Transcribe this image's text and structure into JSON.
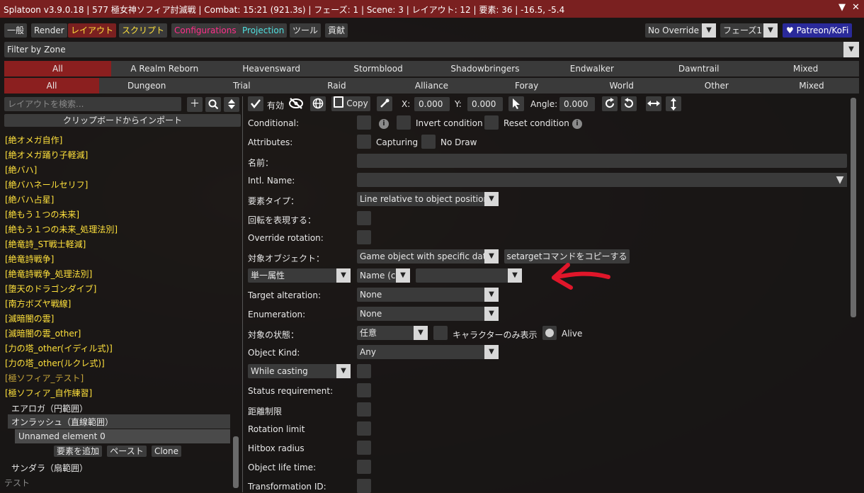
{
  "window": {
    "title": "Splatoon v3.9.0.18 | 577 極女神ソフィア討滅戦 | Combat: 15:21 (921.3s) | フェーズ: 1 | Scene: 3 | レイアウト: 12 | 要素: 36 | -16.5, -5.4",
    "collapse_glyph": "▼",
    "close_glyph": "✕"
  },
  "tabs": [
    {
      "label": "一般",
      "color": "#e8e8e8"
    },
    {
      "label": "Render",
      "color": "#e8e8e8"
    },
    {
      "label": "レイアウト",
      "color": "#ffe13c"
    },
    {
      "label": "スクリプト",
      "color": "#ffe13c"
    },
    {
      "label": "Configurations",
      "color": "#ff2e8a"
    },
    {
      "label": "Projection",
      "color": "#4fe0e0"
    },
    {
      "label": "ツール",
      "color": "#e8e8e8"
    },
    {
      "label": "貢献",
      "color": "#e8e8e8"
    }
  ],
  "top_right": {
    "no_override": "No Override",
    "phase": "フェーズ1",
    "patreon": "♥ Patreon/KoFi"
  },
  "filter": {
    "label": "Filter by Zone"
  },
  "expansions": [
    "All",
    "A Realm Reborn",
    "Heavensward",
    "Stormblood",
    "Shadowbringers",
    "Endwalker",
    "Dawntrail",
    "Mixed"
  ],
  "content_types": [
    "All",
    "Dungeon",
    "Trial",
    "Raid",
    "Alliance",
    "Foray",
    "World",
    "Other",
    "Mixed"
  ],
  "left": {
    "search_placeholder": "レイアウトを検索...",
    "import_button": "クリップボードからインポート",
    "zones": [
      "[絶オメガ自作]",
      "[絶オメガ踊り子軽減]",
      "[絶バハ]",
      "[絶バハネールセリフ]",
      "[絶バハ占星]",
      "[絶もう１つの未来]",
      "[絶もう１つの未来_処理法別]",
      "[絶竜詩_ST戦士軽減]",
      "[絶竜詩戦争]",
      "[絶竜詩戦争_処理法別]",
      "[堕天のドラゴンダイブ]",
      "[南方ボズヤ戦線]",
      "[滅暗闇の雲]",
      "[滅暗闇の雲_other]",
      "[力の塔_other(イディル式)]",
      "[力の塔_other(ルクレ式)]",
      "[極ソフィア_テスト]",
      "[極ソフィア_自作練習]"
    ],
    "layouts": {
      "aeroga": "エアロガ（円範囲）",
      "onrush": "オンラッシュ（直線範囲）",
      "unnamed": "Unnamed element 0",
      "sandaga": "サンダラ（扇範囲）",
      "test": "テスト"
    },
    "add_element": "要素を追加",
    "paste": "ペースト",
    "clone": "Clone"
  },
  "toolbar": {
    "enabled": "有効",
    "copy": "Copy",
    "x_label": "X:",
    "x_value": "0.000",
    "y_label": "Y:",
    "y_value": "0.000",
    "angle_label": "Angle:",
    "angle_value": "0.000"
  },
  "form": {
    "conditional": "Conditional:",
    "invert_condition": "Invert condition",
    "reset_condition": "Reset condition",
    "info_glyph": "i",
    "attributes": "Attributes:",
    "capturing": "Capturing",
    "no_draw": "No Draw",
    "name": "名前：",
    "intl_name": "Intl. Name:",
    "element_type": "要素タイプ：",
    "element_type_value": "Line relative to object position",
    "express_rotation": "回転を表現する：",
    "override_rotation": "Override rotation:",
    "target_object": "対象オブジェクト：",
    "target_object_value": "Game object with specific data",
    "copy_settarget": "setargetコマンドをコピーする",
    "single_attr": "単一属性",
    "name_combo": "Name (c",
    "name_combo_value": "",
    "target_alteration": "Target alteration:",
    "target_alteration_value": "None",
    "enumeration": "Enumeration:",
    "enumeration_value": "None",
    "target_state": "対象の状態：",
    "target_state_value": "任意",
    "character_only": "キャラクターのみ表示",
    "alive": "Alive",
    "object_kind": "Object Kind:",
    "object_kind_value": "Any",
    "while_casting": "While casting",
    "status_requirement": "Status requirement:",
    "distance_limit": "距離制限",
    "rotation_limit": "Rotation limit",
    "hitbox_radius": "Hitbox radius",
    "object_life_time": "Object life time:",
    "transformation_id": "Transformation ID:"
  },
  "colors": {
    "title_bg": "#7a2020",
    "selected_bar": "#8b1f1f",
    "zone_text": "#ffe13c",
    "arrow": "#e0162a"
  }
}
